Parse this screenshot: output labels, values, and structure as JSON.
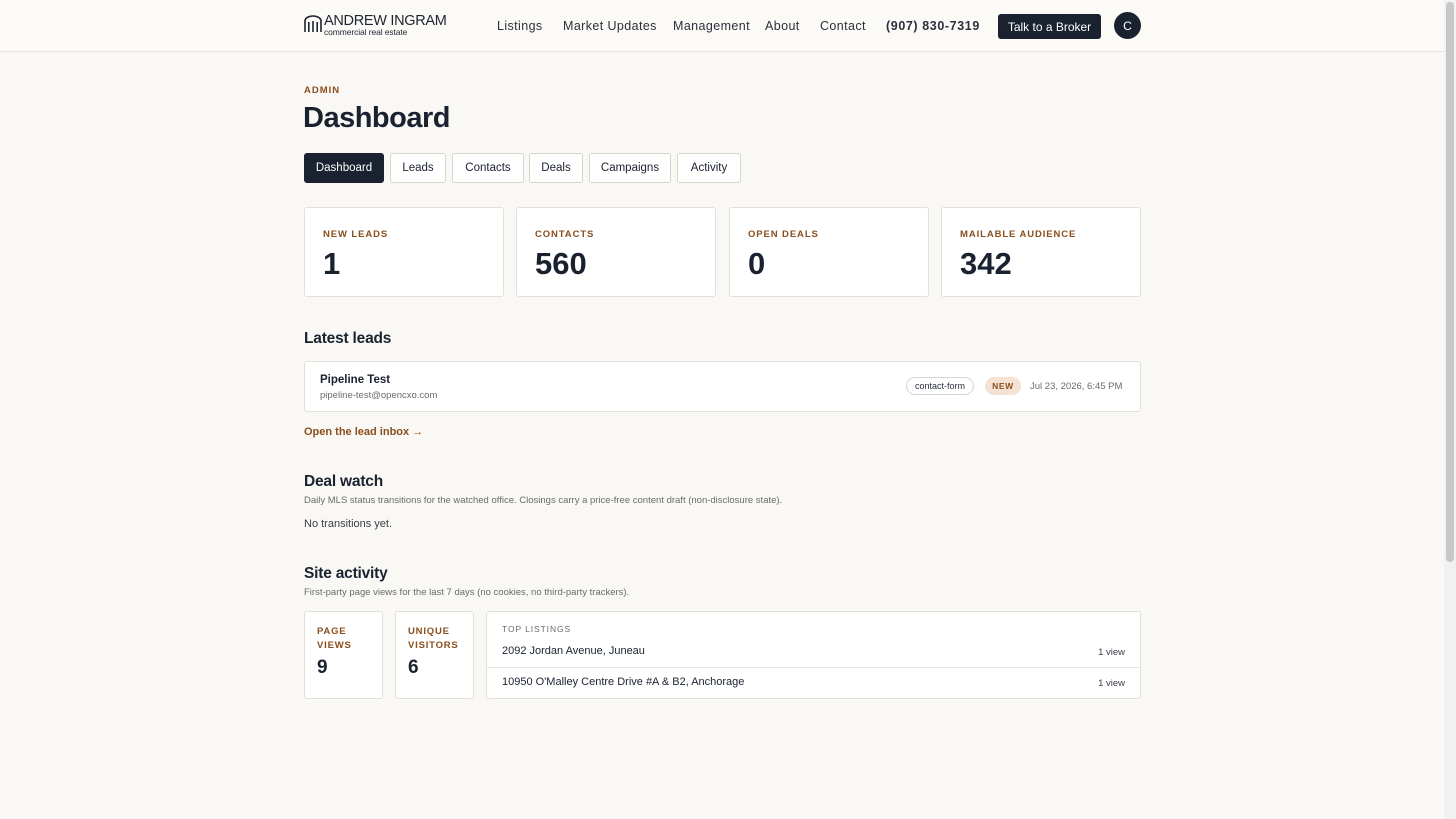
{
  "header": {
    "logo": {
      "name": "ANDREW INGRAM",
      "tagline": "commercial real estate"
    },
    "nav": [
      "Listings",
      "Market Updates",
      "Management",
      "About",
      "Contact"
    ],
    "phone": "(907) 830-7319",
    "cta_label": "Talk to a Broker",
    "avatar_initial": "C"
  },
  "page": {
    "eyebrow": "ADMIN",
    "title": "Dashboard",
    "tabs": [
      "Dashboard",
      "Leads",
      "Contacts",
      "Deals",
      "Campaigns",
      "Activity"
    ],
    "active_tab": "Dashboard"
  },
  "stats": [
    {
      "label": "NEW LEADS",
      "value": "1"
    },
    {
      "label": "CONTACTS",
      "value": "560"
    },
    {
      "label": "OPEN DEALS",
      "value": "0"
    },
    {
      "label": "MAILABLE AUDIENCE",
      "value": "342"
    }
  ],
  "latest_leads": {
    "heading": "Latest leads",
    "items": [
      {
        "name": "Pipeline Test",
        "email": "pipeline-test@opencxo.com",
        "source": "contact-form",
        "status": "NEW",
        "time": "Jul 23, 2026, 6:45 PM"
      }
    ],
    "link_label": "Open the lead inbox →"
  },
  "deal_watch": {
    "heading": "Deal watch",
    "subtitle": "Daily MLS status transitions for the watched office. Closings carry a price-free content draft (non-disclosure state).",
    "empty_text": "No transitions yet."
  },
  "site_activity": {
    "heading": "Site activity",
    "subtitle": "First-party page views for the last 7 days (no cookies, no third-party trackers).",
    "metrics": [
      {
        "label": "PAGE VIEWS",
        "value": "9"
      },
      {
        "label": "UNIQUE VISITORS",
        "value": "6"
      }
    ],
    "top_listings": {
      "header": "TOP LISTINGS",
      "items": [
        {
          "name": "2092 Jordan Avenue, Juneau",
          "views": "1 view"
        },
        {
          "name": "10950 O'Malley Centre Drive #A & B2, Anchorage",
          "views": "1 view"
        }
      ]
    }
  },
  "colors": {
    "navy": "#1a2230",
    "accent": "#8a4e1d",
    "background": "#f9f8f4",
    "badge_bg": "#f5e2d3"
  }
}
